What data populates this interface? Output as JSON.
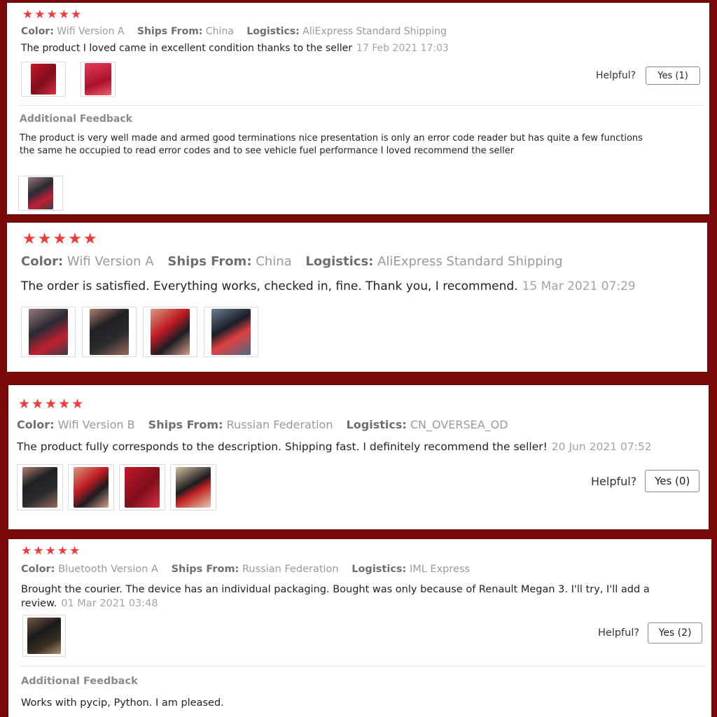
{
  "reviews": [
    {
      "stars": "★★★★★",
      "color_label": "Color:",
      "color_value": "Wifi Version A",
      "ships_label": "Ships From:",
      "ships_value": "China",
      "logistics_label": "Logistics:",
      "logistics_value": "AliExpress Standard Shipping",
      "text": "The product I loved came in excellent condition thanks to the seller",
      "date": "17 Feb 2021 17:03",
      "helpful_label": "Helpful?",
      "yes_label": "Yes (1)",
      "additional_title": "Additional Feedback",
      "additional_text": "The product is very well made and armed good terminations nice presentation is only an error code reader but has quite a few functions the same he occupied to read error codes and to see vehicle fuel performance I loved recommend the seller"
    },
    {
      "stars": "★★★★★",
      "color_label": "Color:",
      "color_value": "Wifi Version A",
      "ships_label": "Ships From:",
      "ships_value": "China",
      "logistics_label": "Logistics:",
      "logistics_value": "AliExpress Standard Shipping",
      "text": "The order is satisfied. Everything works, checked in, fine. Thank you, I recommend.",
      "date": "15 Mar 2021 07:29"
    },
    {
      "stars": "★★★★★",
      "color_label": "Color:",
      "color_value": "Wifi Version B",
      "ships_label": "Ships From:",
      "ships_value": "Russian Federation",
      "logistics_label": "Logistics:",
      "logistics_value": "CN_OVERSEA_OD",
      "text": "The product fully corresponds to the description. Shipping fast. I definitely recommend the seller!",
      "date": "20 Jun 2021 07:52",
      "helpful_label": "Helpful?",
      "yes_label": "Yes (0)"
    },
    {
      "stars": "★★★★★",
      "color_label": "Color:",
      "color_value": "Bluetooth Version A",
      "ships_label": "Ships From:",
      "ships_value": "Russian Federation",
      "logistics_label": "Logistics:",
      "logistics_value": "IML Express",
      "text": "Brought the courier. The device has an individual packaging. Bought was only because of Renault Megan 3. I'll try, I'll add a review.",
      "date": "01 Mar 2021 03:48",
      "helpful_label": "Helpful?",
      "yes_label": "Yes (2)",
      "additional_title": "Additional Feedback",
      "additional_text": "Works with pycip, Python. I am pleased."
    }
  ],
  "colors": {
    "background": "#7a0a0a",
    "star": "#f23a3a"
  }
}
